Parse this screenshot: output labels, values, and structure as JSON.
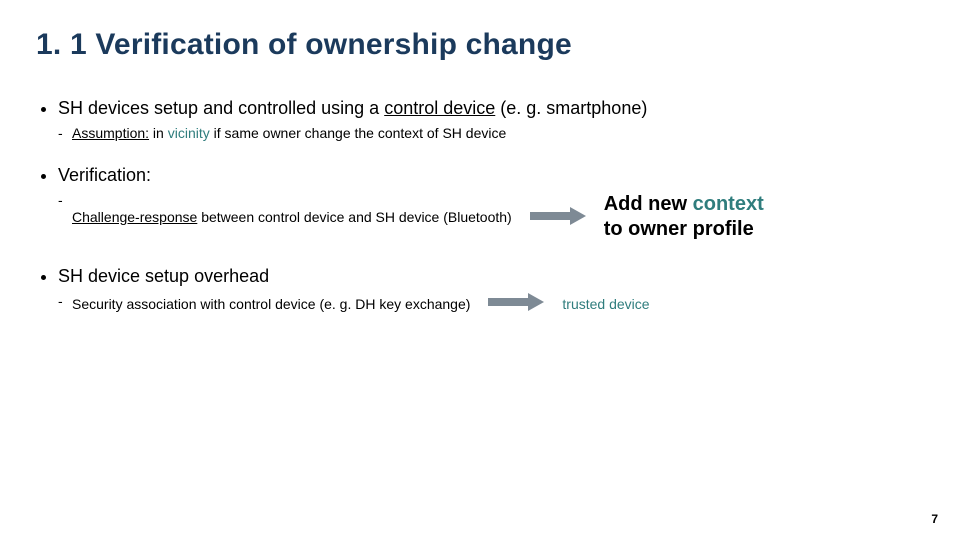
{
  "title": "1. 1 Verification of ownership change",
  "bullet1": {
    "prefix": "SH devices setup and controlled using a ",
    "link": "control device",
    "suffix": " (e. g. smartphone)",
    "sub": {
      "label": "Assumption:",
      "text1": " in ",
      "emph": "vicinity",
      "text2": " if same owner change the context of SH device"
    }
  },
  "bullet2": {
    "label": "Verification:",
    "sub": {
      "link": "Challenge-response",
      "text": " between control device and SH device (Bluetooth)"
    },
    "callout": {
      "line1_a": "Add new ",
      "line1_b": "context",
      "line2": "to owner profile"
    }
  },
  "bullet3": {
    "label": "SH device setup overhead",
    "sub": {
      "text": "Security association with control device (e. g. DH key exchange)",
      "result": "trusted device"
    }
  },
  "arrow_color": "#7e8a95",
  "page": "7"
}
